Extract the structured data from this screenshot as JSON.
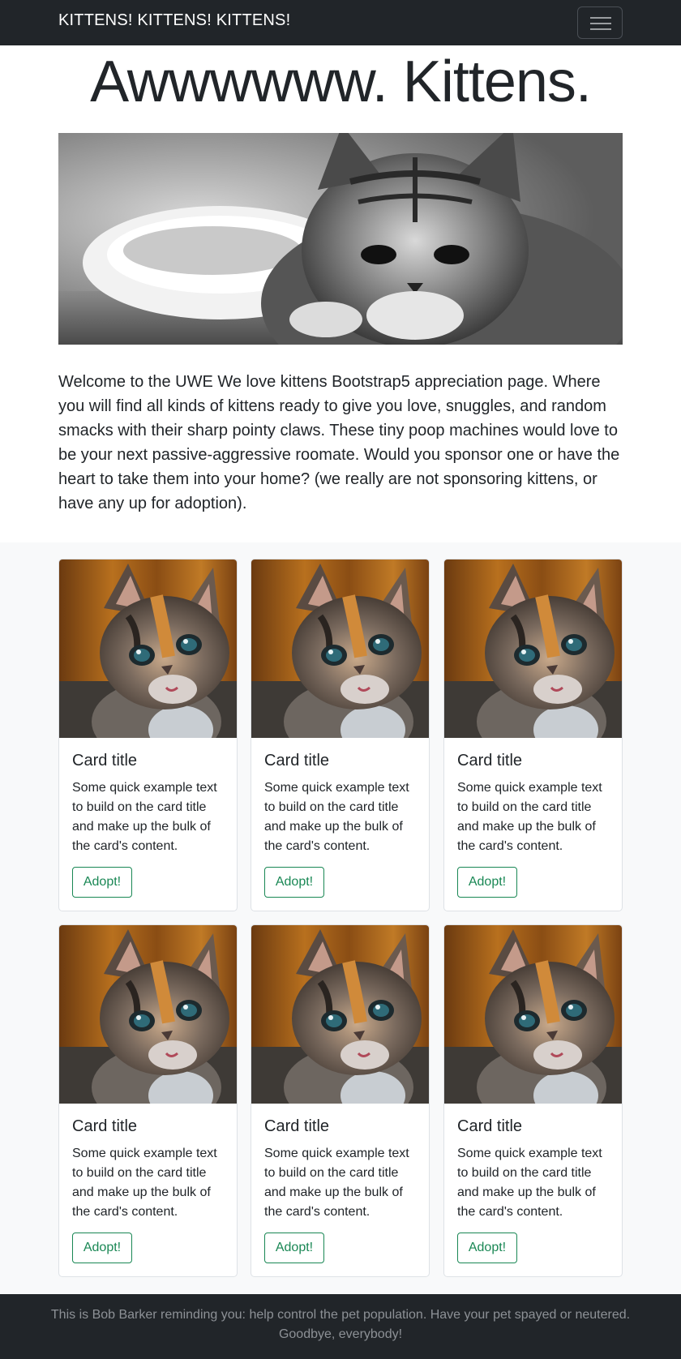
{
  "navbar": {
    "brand": "KITTENS! KITTENS! KITTENS!",
    "toggler_icon": "hamburger-menu-icon",
    "background": "#212529"
  },
  "hero": {
    "title": "Awwwwww. Kittens.",
    "image": "kitten-drinking-bw-photo"
  },
  "intro": {
    "text": "Welcome to the UWE We love kittens Bootstrap5 appreciation page. Where you will find all kinds of kittens ready to give you love, snuggles, and random smacks with their sharp pointy claws. These tiny poop machines would love to be your next passive-aggressive roomate. Would you sponsor one or have the heart to take them into your home? (we really are not sponsoring kittens, or have any up for adoption)."
  },
  "cards": [
    {
      "image": "calico-kitten-photo",
      "title": "Card title",
      "text": "Some quick example text to build on the card title and make up the bulk of the card's content.",
      "button": "Adopt!"
    },
    {
      "image": "calico-kitten-photo",
      "title": "Card title",
      "text": "Some quick example text to build on the card title and make up the bulk of the card's content.",
      "button": "Adopt!"
    },
    {
      "image": "calico-kitten-photo",
      "title": "Card title",
      "text": "Some quick example text to build on the card title and make up the bulk of the card's content.",
      "button": "Adopt!"
    },
    {
      "image": "calico-kitten-photo",
      "title": "Card title",
      "text": "Some quick example text to build on the card title and make up the bulk of the card's content.",
      "button": "Adopt!"
    },
    {
      "image": "calico-kitten-photo",
      "title": "Card title",
      "text": "Some quick example text to build on the card title and make up the bulk of the card's content.",
      "button": "Adopt!"
    },
    {
      "image": "calico-kitten-photo",
      "title": "Card title",
      "text": "Some quick example text to build on the card title and make up the bulk of the card's content.",
      "button": "Adopt!"
    }
  ],
  "footer": {
    "text": "This is Bob Barker reminding you: help control the pet population. Have your pet spayed or neutered. Goodbye, everybody!"
  },
  "colors": {
    "dark": "#212529",
    "success": "#198754",
    "light_bg": "#f8f9fa"
  }
}
